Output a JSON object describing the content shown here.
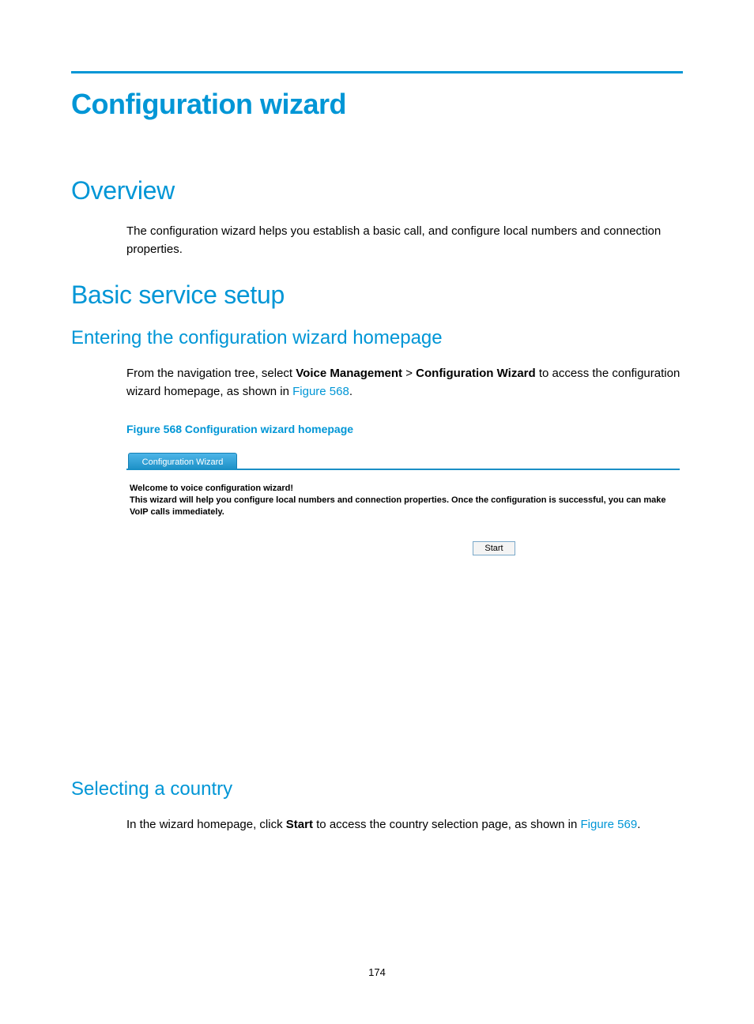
{
  "page_number": "174",
  "main_title": "Configuration wizard",
  "overview": {
    "heading": "Overview",
    "paragraph": "The configuration wizard helps you establish a basic call, and configure local numbers and connection properties."
  },
  "basic_service": {
    "heading": "Basic service setup"
  },
  "entering": {
    "heading": "Entering the configuration wizard homepage",
    "para_prefix": "From the navigation tree, select ",
    "nav_1": "Voice Management",
    "nav_sep": " > ",
    "nav_2": "Configuration Wizard",
    "para_mid": " to access the configuration wizard homepage, as shown in ",
    "link": "Figure 568",
    "para_suffix": "."
  },
  "figure": {
    "caption": "Figure 568 Configuration wizard homepage",
    "tab_label": "Configuration Wizard",
    "welcome": "Welcome to voice configuration wizard!",
    "description": "This wizard will help you configure local numbers and connection properties. Once the configuration is successful, you can make VoIP calls immediately.",
    "start_button": "Start"
  },
  "selecting": {
    "heading": "Selecting a country",
    "para_prefix": "In the wizard homepage, click ",
    "bold": "Start",
    "para_mid": " to access the country selection page, as shown in ",
    "link": "Figure 569",
    "para_suffix": "."
  }
}
